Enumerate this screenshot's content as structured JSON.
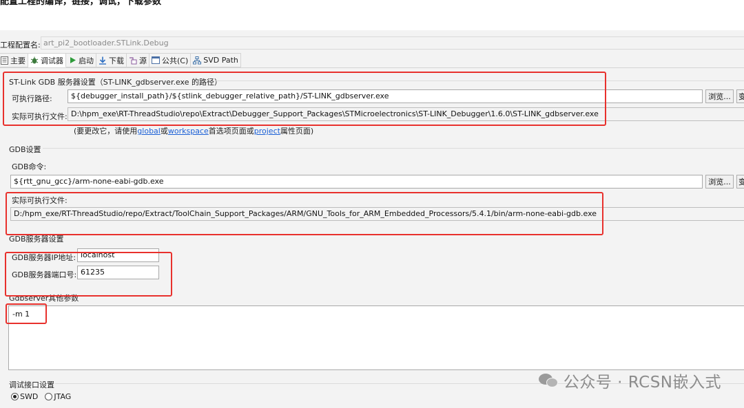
{
  "article": {
    "heading": "配置工程的编译，链接，调试，下载参数"
  },
  "config": {
    "name_label": "工程配置名:",
    "name_value": "art_pi2_bootloader.STLink.Debug"
  },
  "tabs": [
    {
      "label": "主要",
      "icon": "main-tab-icon"
    },
    {
      "label": "调试器",
      "icon": "debugger-tab-icon"
    },
    {
      "label": "启动",
      "icon": "startup-tab-icon"
    },
    {
      "label": "下载",
      "icon": "download-tab-icon"
    },
    {
      "label": "源",
      "icon": "source-tab-icon"
    },
    {
      "label": "公共(C)",
      "icon": "common-tab-icon"
    },
    {
      "label": "SVD Path",
      "icon": "svd-tab-icon"
    }
  ],
  "active_tab": "调试器",
  "stlink_group": {
    "title": "ST-Link GDB 服务器设置（ST-LINK_gdbserver.exe 的路径）",
    "exec_path_label": "可执行路径:",
    "exec_path_value": "${debugger_install_path}/${stlink_debugger_relative_path}/ST-LINK_gdbserver.exe",
    "browse_label": "浏览...",
    "var_label": "变",
    "actual_label": "实际可执行文件:",
    "actual_value": "D:\\hpm_exe\\RT-ThreadStudio\\repo\\Extract\\Debugger_Support_Packages\\STMicroelectronics\\ST-LINK_Debugger\\1.6.0\\ST-LINK_gdbserver.exe",
    "hint_prefix": "(要更改它，请使用",
    "hint_global": "global",
    "hint_or": "或",
    "hint_workspace": "workspace",
    "hint_mid": "首选项页面或",
    "hint_project": "project",
    "hint_suffix": "属性页面)"
  },
  "gdb_group": {
    "title": "GDB设置",
    "command_label": "GDB命令:",
    "command_value": "${rtt_gnu_gcc}/arm-none-eabi-gdb.exe",
    "browse_label": "浏览...",
    "var_label": "变",
    "actual_label": "实际可执行文件:",
    "actual_value": "D:/hpm_exe/RT-ThreadStudio/repo/Extract/ToolChain_Support_Packages/ARM/GNU_Tools_for_ARM_Embedded_Processors/5.4.1/bin/arm-none-eabi-gdb.exe"
  },
  "server_group": {
    "title": "GDB服务器设置",
    "ip_label": "GDB服务器IP地址:",
    "ip_value": "localhost",
    "port_label": "GDB服务器端口号:",
    "port_value": "61235"
  },
  "gdbserver_args": {
    "title": "Gdbserver其他参数",
    "value": "-m 1"
  },
  "debug_interface": {
    "title": "调试接口设置",
    "options": [
      "SWD",
      "JTAG"
    ],
    "selected": "SWD"
  },
  "watermark": {
    "text": "公众号 · RCSN嵌入式",
    "icon": "wechat-icon"
  },
  "colors": {
    "highlight_box": "#e8302c",
    "link": "#1a5fd6",
    "panel_bg": "#f3f3f3"
  }
}
